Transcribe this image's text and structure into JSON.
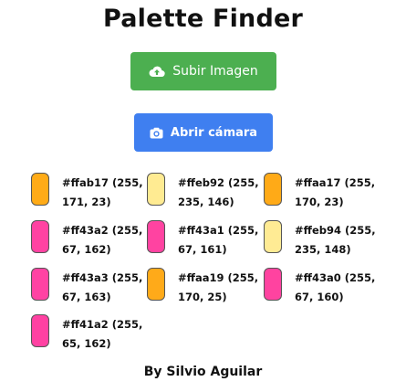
{
  "app": {
    "title": "Palette Finder",
    "footer": "By Silvio Aguilar"
  },
  "buttons": {
    "upload": {
      "label": "Subir Imagen",
      "icon": "cloud-upload-icon",
      "color": "#4caf50"
    },
    "camera": {
      "label": "Abrir cámara",
      "icon": "camera-icon",
      "color": "#3f7ff0"
    }
  },
  "palette": [
    {
      "color": "#ffab17",
      "text": "#ffab17 (255, 171, 23)"
    },
    {
      "color": "#ffeb92",
      "text": "#ffeb92 (255, 235, 146)"
    },
    {
      "color": "#ffaa17",
      "text": "#ffaa17 (255, 170, 23)"
    },
    {
      "color": "#ff43a2",
      "text": "#ff43a2 (255, 67, 162)"
    },
    {
      "color": "#ff43a1",
      "text": "#ff43a1 (255, 67, 161)"
    },
    {
      "color": "#ffeb94",
      "text": "#ffeb94 (255, 235, 148)"
    },
    {
      "color": "#ff43a3",
      "text": "#ff43a3 (255, 67, 163)"
    },
    {
      "color": "#ffaa19",
      "text": "#ffaa19 (255, 170, 25)"
    },
    {
      "color": "#ff43a0",
      "text": "#ff43a0 (255, 67, 160)"
    },
    {
      "color": "#ff41a2",
      "text": "#ff41a2 (255, 65, 162)"
    }
  ]
}
